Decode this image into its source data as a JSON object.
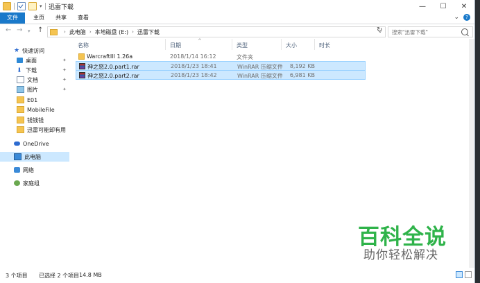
{
  "window": {
    "title": "迅雷下载",
    "controls": {
      "minimize": "—",
      "maximize": "☐",
      "close": "✕"
    }
  },
  "ribbon": {
    "tabs": [
      "文件",
      "主页",
      "共享",
      "查看"
    ],
    "help": "?"
  },
  "address": {
    "crumbs": [
      "此电脑",
      "本地磁盘 (E:)",
      "迅雷下载"
    ],
    "search_placeholder": "搜索\"迅雷下载\""
  },
  "navpane": {
    "items": [
      {
        "label": "快速访问",
        "icon": "star-icon",
        "pinned": false
      },
      {
        "label": "桌面",
        "icon": "desktop-icon",
        "pinned": true
      },
      {
        "label": "下载",
        "icon": "download-icon",
        "pinned": true
      },
      {
        "label": "文档",
        "icon": "document-icon",
        "pinned": true
      },
      {
        "label": "图片",
        "icon": "pictures-icon",
        "pinned": true
      },
      {
        "label": "E01",
        "icon": "folder-icon",
        "pinned": false
      },
      {
        "label": "MobileFile",
        "icon": "folder-icon",
        "pinned": false
      },
      {
        "label": "钱钱钱",
        "icon": "folder-icon",
        "pinned": false
      },
      {
        "label": "迅雷可能卸有用",
        "icon": "folder-icon",
        "pinned": false
      },
      {
        "label": "OneDrive",
        "icon": "cloud-icon",
        "pinned": false
      },
      {
        "label": "此电脑",
        "icon": "computer-icon",
        "pinned": false
      },
      {
        "label": "网络",
        "icon": "network-icon",
        "pinned": false
      },
      {
        "label": "家庭组",
        "icon": "homegroup-icon",
        "pinned": false
      }
    ]
  },
  "filelist": {
    "columns": [
      "名称",
      "日期",
      "类型",
      "大小",
      "时长"
    ],
    "rows": [
      {
        "name": "WarcraftIII 1.26a",
        "date": "2018/1/14 16:12",
        "type": "文件夹",
        "size": "",
        "icon": "folder-icon",
        "selected": false
      },
      {
        "name": "神之怒2.0.part1.rar",
        "date": "2018/1/23 18:41",
        "type": "WinRAR 压缩文件",
        "size": "8,192 KB",
        "icon": "rar-archive-icon",
        "selected": true
      },
      {
        "name": "神之怒2.0.part2.rar",
        "date": "2018/1/23 18:42",
        "type": "WinRAR 压缩文件",
        "size": "6,981 KB",
        "icon": "rar-archive-icon",
        "selected": true
      }
    ]
  },
  "status": {
    "count": "3 个项目",
    "selected": "已选择 2 个项目",
    "size": "14.8 MB"
  },
  "watermark": {
    "title": "百科全说",
    "subtitle": "助你轻松解决"
  },
  "colors": {
    "accent": "#1979ca",
    "selection": "#cce8ff",
    "watermark_green": "#2fb34a"
  }
}
